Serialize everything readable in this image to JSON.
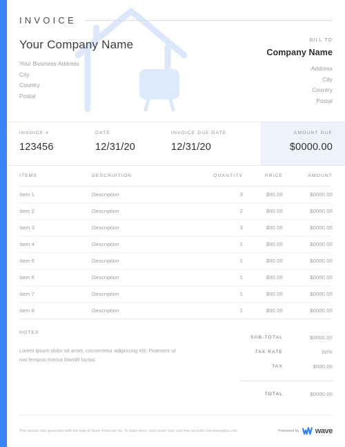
{
  "document": {
    "title": "INVOICE"
  },
  "sender": {
    "company_name": "Your Company Name",
    "address_lines": [
      "Your Business Address",
      "City",
      "Country",
      "Postal"
    ]
  },
  "bill_to": {
    "label": "BILL TO",
    "company_name": "Company Name",
    "address_lines": [
      "Address",
      "City",
      "Country",
      "Postal"
    ]
  },
  "meta": {
    "invoice_number": {
      "label": "INVOICE #",
      "value": "123456"
    },
    "date": {
      "label": "DATE",
      "value": "12/31/20"
    },
    "due_date": {
      "label": "INVOICE DUE DATE",
      "value": "12/31/20"
    },
    "amount_due": {
      "label": "AMOUNT DUE",
      "value": "$0000.00"
    }
  },
  "items_table": {
    "headers": {
      "items": "ITEMS",
      "description": "DESCRIPTION",
      "quantity": "QUANTITY",
      "price": "PRICE",
      "amount": "AMOUNT"
    },
    "rows": [
      {
        "item": "Item 1",
        "description": "Description",
        "quantity": "3",
        "price": "$00.00",
        "amount": "$0000.00"
      },
      {
        "item": "Item 2",
        "description": "Description",
        "quantity": "2",
        "price": "$00.00",
        "amount": "$0000.00"
      },
      {
        "item": "Item 3",
        "description": "Description",
        "quantity": "3",
        "price": "$00.00",
        "amount": "$0000.00"
      },
      {
        "item": "Item 4",
        "description": "Description",
        "quantity": "1",
        "price": "$00.00",
        "amount": "$0000.00"
      },
      {
        "item": "Item 5",
        "description": "Description",
        "quantity": "1",
        "price": "$00.00",
        "amount": "$0000.00"
      },
      {
        "item": "Item 6",
        "description": "Description",
        "quantity": "1",
        "price": "$00.00",
        "amount": "$0000.00"
      },
      {
        "item": "Item 7",
        "description": "Description",
        "quantity": "1",
        "price": "$00.00",
        "amount": "$0000.00"
      },
      {
        "item": "Item 8",
        "description": "Description",
        "quantity": "1",
        "price": "$00.00",
        "amount": "$0000.00"
      }
    ]
  },
  "notes": {
    "label": "NOTES",
    "text": "Lorem ipsum dolor sit amet, consectetur adipiscing elit. Praesent ut nisi tempus massa blandit luctus."
  },
  "totals": {
    "sub_total": {
      "label": "SUB-TOTAL",
      "value": "$0000.00"
    },
    "tax_rate": {
      "label": "TAX RATE",
      "value": "00%"
    },
    "tax": {
      "label": "TAX",
      "value": "$000.00"
    },
    "total": {
      "label": "TOTAL",
      "value": "$0000.00"
    }
  },
  "footer": {
    "disclaimer": "This invoice was generated with the help of Wave Financial Inc. To learn more, and create your own free account visit waveapps.com",
    "powered_by_label": "Powered by",
    "brand_name": "wave"
  },
  "colors": {
    "accent_bar": "#3b82f6",
    "amount_due_panel": "#eef2fd",
    "watermark": "#dce7fb",
    "brand_blue": "#2f80f0"
  },
  "watermark": {
    "icon_name": "house-with-sign-watermark"
  }
}
